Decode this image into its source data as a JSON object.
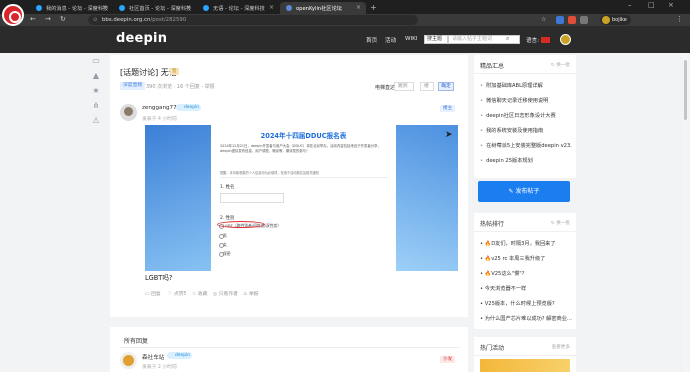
{
  "browser": {
    "tabs": [
      {
        "label": "我的消息 - 论坛 - 深度科技"
      },
      {
        "label": "社区首页 - 论坛 - 深度科技"
      },
      {
        "label": "无语 - 论坛 - 深度科技"
      },
      {
        "label": "openKylin社区论坛"
      }
    ],
    "url_domain": "bbs.deepin.org.cn",
    "url_path": "/post/282590",
    "profile_name": "bojike"
  },
  "site": {
    "logo": "deepin",
    "nav": [
      "首页",
      "活动",
      "WIKI"
    ],
    "search_scope": "搜主题",
    "search_placeholder": "请输入帖子主题词",
    "lang_label": "语言:"
  },
  "post": {
    "title": "[话题讨论] 无语",
    "title_tag": "晋",
    "category": "深度音频",
    "meta": "390 次浏览 · 16 个回复 · 举报",
    "order_label": "电梯直达",
    "order_floor": "跳到",
    "order_unit": "楼",
    "order_ok": "确定",
    "author": "zenggang770",
    "author_badge": "deepin",
    "time": "发表于 4 小时前",
    "floor": "楼主",
    "body_text": "LGBT吗?",
    "actions": [
      "回复",
      "点赞5",
      "收藏",
      "只看作者",
      "举报"
    ]
  },
  "screenshot_form": {
    "title": "2024年十四届DDUC报名表",
    "desc": "2024年12月21日，deepin开发者与用户大会（DDUC）将在北京举办。活动内容包括来自于开发者分享、deepin团队发布信息、用户调查、畅谈等，期待您的参与！",
    "note": "提醒：本问卷收集的个人信息均为必填项，仅用于活动报名及相关通知",
    "q1": "1. 姓名",
    "q2": "2. 性别",
    "options": [
      "LGBT（跨性别者/同性恋/双性恋）",
      "男",
      "女",
      "保密"
    ]
  },
  "replies": {
    "title": "所有回复",
    "first": {
      "name": "森社车站",
      "badge": "deepin",
      "time": "发表于 2 小时前",
      "floor": "沙发"
    }
  },
  "sidebar": {
    "best": {
      "title": "精品汇总",
      "refresh": "换一批",
      "items": [
        "附加基础库ABL原理详解",
        "微信聊天记录迁移使用说明",
        "deepin社区日志形象设计大赛",
        "我的系统安装及使用指南",
        "在树莓派5上安装完整版deepin v23...",
        "deepin 25版本规划"
      ]
    },
    "new_post": "发布帖子",
    "hot": {
      "title": "热帖排行",
      "refresh": "换一批",
      "items": [
        {
          "fire": true,
          "text": "D友们，时隔3月，我回来了"
        },
        {
          "fire": true,
          "text": "v25 rc 本周三我升级了"
        },
        {
          "fire": true,
          "text": "V25这么\"慢\"?"
        },
        {
          "fire": false,
          "text": "今天浏览器不一样"
        },
        {
          "fire": false,
          "text": "V25版本，什么时候上预览版?"
        },
        {
          "fire": false,
          "text": "为什么国产芯片难以成功? 解密商业..."
        }
      ]
    },
    "activity": {
      "title": "热门活动",
      "more": "查看更多"
    }
  }
}
